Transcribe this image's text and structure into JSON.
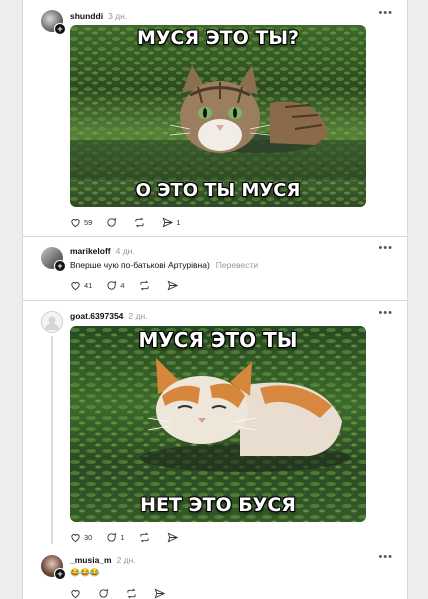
{
  "posts": [
    {
      "username": "shunddi",
      "time": "3 дн.",
      "image": {
        "top_caption": "МУСЯ ЭТО ТЫ?",
        "bottom_caption": "О ЭТО ТЫ МУСЯ"
      },
      "likes": "59",
      "comments": "",
      "reposts": "",
      "shares": "1"
    },
    {
      "username": "marikeloff",
      "time": "4 дн.",
      "text": "Вперше чую по-батькові Артурівна)",
      "translate": "Перевести",
      "likes": "41",
      "comments": "4",
      "reposts": "",
      "shares": ""
    },
    {
      "username": "goat.6397354",
      "time": "2 дн.",
      "image": {
        "top_caption": "МУСЯ ЭТО ТЫ",
        "bottom_caption": "НЕТ ЭТО БУСЯ"
      },
      "likes": "30",
      "comments": "1",
      "reposts": "",
      "shares": ""
    },
    {
      "username": "_musia_m",
      "time": "2 дн.",
      "text": "😂😂😂",
      "likes": "",
      "comments": "",
      "reposts": "",
      "shares": ""
    }
  ],
  "icons": {
    "like": "heart-icon",
    "comment": "comment-icon",
    "repost": "repost-icon",
    "share": "share-icon",
    "more": "more-icon"
  },
  "colors": {
    "water": "#2f4a2b",
    "algae": "#4f7a2e",
    "muted": "#999999"
  }
}
